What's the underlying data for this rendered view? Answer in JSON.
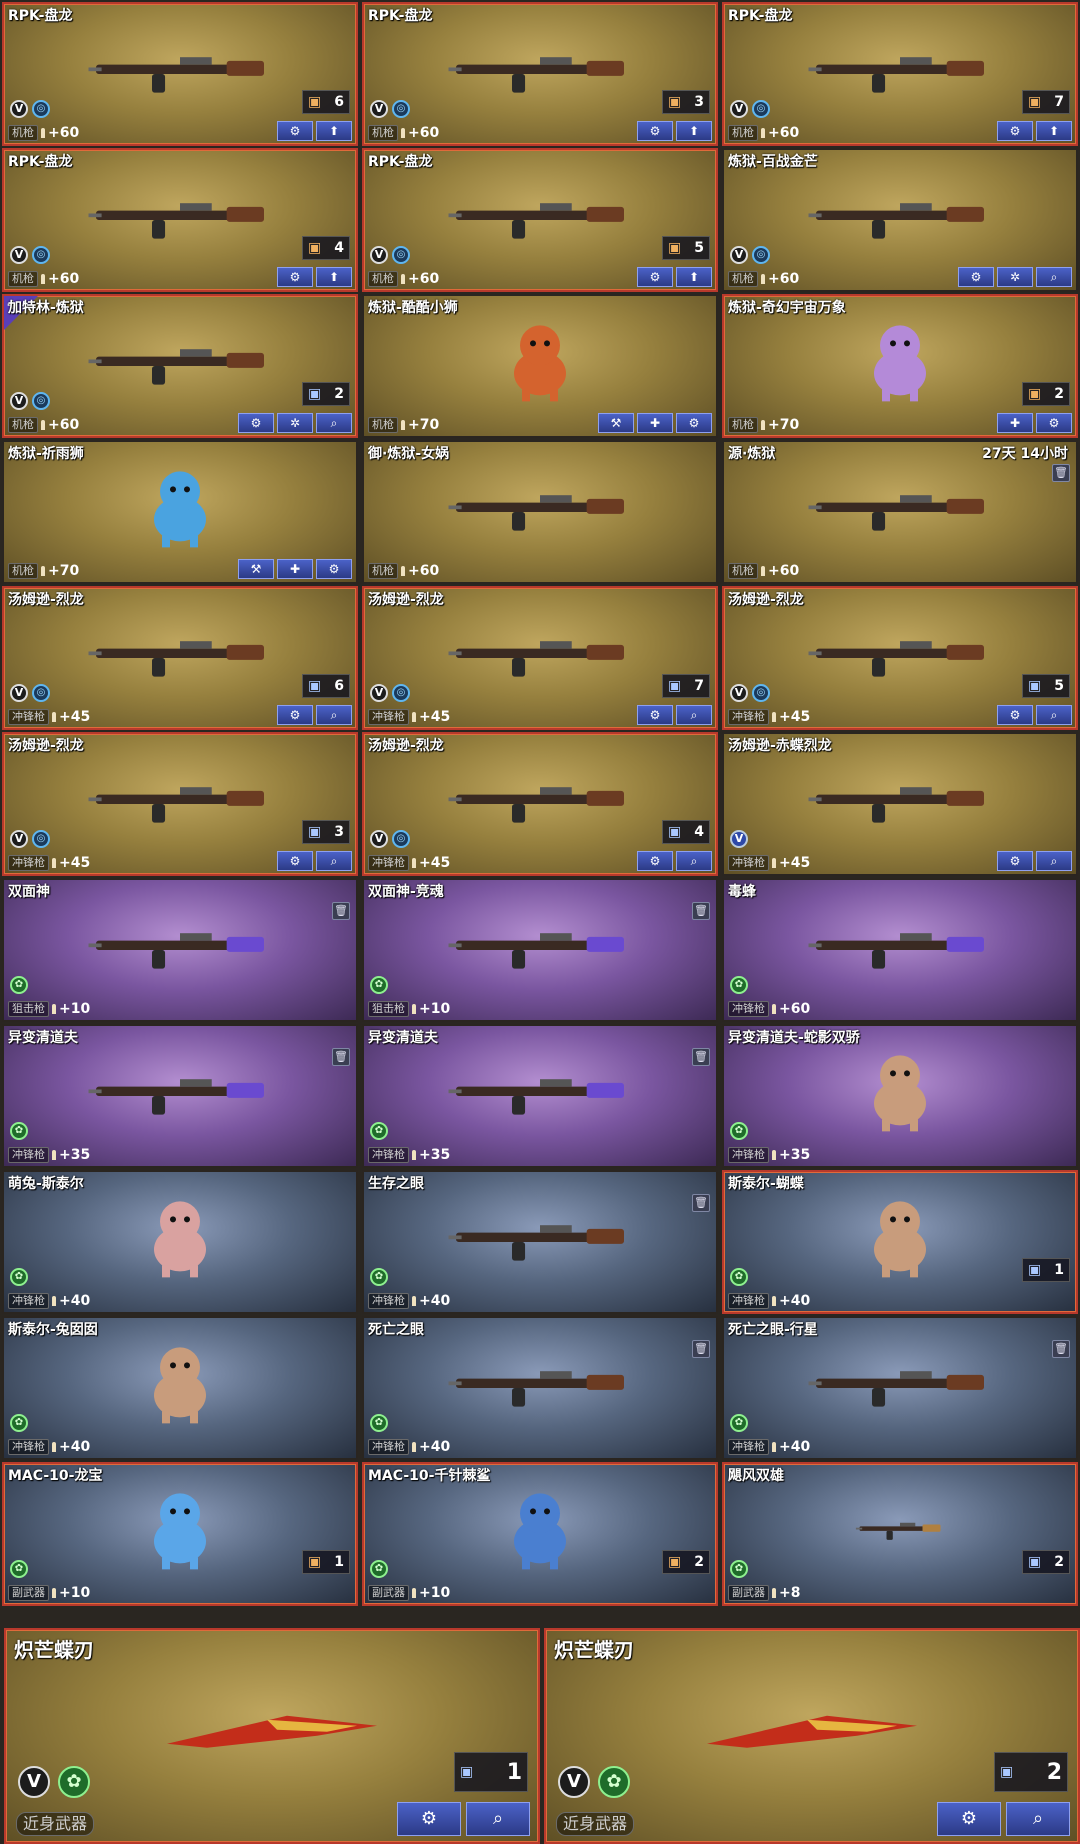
{
  "cards": [
    {
      "name": "RPK-盘龙",
      "type": "机枪",
      "stat": "+60",
      "count": "6",
      "bg": "gold",
      "hl": true,
      "art": "gun-icon",
      "badges": [
        "v",
        "ring"
      ],
      "box": "orange",
      "buttons": [
        "gear-wrench-icon",
        "up-arrow-icon"
      ]
    },
    {
      "name": "RPK-盘龙",
      "type": "机枪",
      "stat": "+60",
      "count": "3",
      "bg": "gold",
      "hl": true,
      "art": "gun-icon",
      "badges": [
        "v",
        "ring"
      ],
      "box": "orange",
      "buttons": [
        "gear-wrench-icon",
        "up-arrow-icon"
      ]
    },
    {
      "name": "RPK-盘龙",
      "type": "机枪",
      "stat": "+60",
      "count": "7",
      "bg": "gold",
      "hl": true,
      "art": "gun-icon",
      "badges": [
        "v",
        "ring"
      ],
      "box": "orange",
      "buttons": [
        "gear-wrench-icon",
        "up-arrow-icon"
      ]
    },
    {
      "name": "RPK-盘龙",
      "type": "机枪",
      "stat": "+60",
      "count": "4",
      "bg": "gold",
      "hl": true,
      "art": "gun-icon",
      "badges": [
        "v",
        "ring"
      ],
      "box": "orange",
      "buttons": [
        "gear-wrench-icon",
        "up-arrow-icon"
      ]
    },
    {
      "name": "RPK-盘龙",
      "type": "机枪",
      "stat": "+60",
      "count": "5",
      "bg": "gold",
      "hl": true,
      "art": "gun-icon",
      "badges": [
        "v",
        "ring"
      ],
      "box": "orange",
      "buttons": [
        "gear-wrench-icon",
        "up-arrow-icon"
      ]
    },
    {
      "name": "炼狱-百战金芒",
      "type": "机枪",
      "stat": "+60",
      "count": "",
      "bg": "gold",
      "hl": false,
      "art": "gun-icon",
      "badges": [
        "v",
        "ring"
      ],
      "box": "",
      "buttons": [
        "gear-wrench-icon",
        "gear-icon",
        "search-icon"
      ]
    },
    {
      "name": "加特林-炼狱",
      "type": "机枪",
      "stat": "+60",
      "count": "2",
      "bg": "gold",
      "hl": true,
      "art": "gun-icon",
      "badges": [
        "v",
        "ring"
      ],
      "box": "blue",
      "buttons": [
        "gear-wrench-icon",
        "gear-icon",
        "search-icon"
      ],
      "corner": true
    },
    {
      "name": "炼狱-酷酷小狮",
      "type": "机枪",
      "stat": "+70",
      "count": "",
      "bg": "gold",
      "hl": false,
      "art": "lion-icon",
      "badges": [],
      "box": "",
      "buttons": [
        "hammer-icon",
        "tools-icon",
        "gear-wrench-icon"
      ]
    },
    {
      "name": "炼狱-奇幻宇宙万象",
      "type": "机枪",
      "stat": "+70",
      "count": "2",
      "bg": "gold",
      "hl": true,
      "art": "elephant-icon",
      "badges": [],
      "box": "orange",
      "buttons": [
        "tools-icon",
        "gear-wrench-icon"
      ]
    },
    {
      "name": "炼狱-祈雨狮",
      "type": "机枪",
      "stat": "+70",
      "count": "",
      "bg": "gold",
      "hl": false,
      "art": "lion-icon",
      "badges": [],
      "box": "",
      "buttons": [
        "hammer-icon",
        "tools-icon",
        "gear-wrench-icon"
      ]
    },
    {
      "name": "御·炼狱-女娲",
      "type": "机枪",
      "stat": "+60",
      "count": "",
      "bg": "gold",
      "hl": false,
      "art": "gun-icon",
      "badges": [],
      "box": "",
      "buttons": []
    },
    {
      "name": "源·炼狱",
      "type": "机枪",
      "stat": "+60",
      "count": "",
      "bg": "gold",
      "hl": false,
      "art": "gun-icon",
      "badges": [],
      "box": "",
      "buttons": [],
      "timer": "27天 14小时",
      "trash": true
    },
    {
      "name": "汤姆逊-烈龙",
      "type": "冲锋枪",
      "stat": "+45",
      "count": "6",
      "bg": "gold",
      "hl": true,
      "art": "gun-icon",
      "badges": [
        "v",
        "ring"
      ],
      "box": "blue",
      "buttons": [
        "gear-wrench-icon",
        "search-icon"
      ]
    },
    {
      "name": "汤姆逊-烈龙",
      "type": "冲锋枪",
      "stat": "+45",
      "count": "7",
      "bg": "gold",
      "hl": true,
      "art": "gun-icon",
      "badges": [
        "v",
        "ring"
      ],
      "box": "blue",
      "buttons": [
        "gear-wrench-icon",
        "search-icon"
      ]
    },
    {
      "name": "汤姆逊-烈龙",
      "type": "冲锋枪",
      "stat": "+45",
      "count": "5",
      "bg": "gold",
      "hl": true,
      "art": "gun-icon",
      "badges": [
        "v",
        "ring"
      ],
      "box": "blue",
      "buttons": [
        "gear-wrench-icon",
        "search-icon"
      ]
    },
    {
      "name": "汤姆逊-烈龙",
      "type": "冲锋枪",
      "stat": "+45",
      "count": "3",
      "bg": "gold",
      "hl": true,
      "art": "gun-icon",
      "badges": [
        "v",
        "ring"
      ],
      "box": "blue",
      "buttons": [
        "gear-wrench-icon",
        "search-icon"
      ]
    },
    {
      "name": "汤姆逊-烈龙",
      "type": "冲锋枪",
      "stat": "+45",
      "count": "4",
      "bg": "gold",
      "hl": true,
      "art": "gun-icon",
      "badges": [
        "v",
        "ring"
      ],
      "box": "blue",
      "buttons": [
        "gear-wrench-icon",
        "search-icon"
      ]
    },
    {
      "name": "汤姆逊-赤蝶烈龙",
      "type": "冲锋枪",
      "stat": "+45",
      "count": "",
      "bg": "gold",
      "hl": false,
      "art": "gun-icon",
      "badges": [
        "vblue"
      ],
      "box": "",
      "buttons": [
        "gear-wrench-icon",
        "search-icon"
      ]
    },
    {
      "name": "双面神",
      "type": "狙击枪",
      "stat": "+10",
      "count": "",
      "bg": "purple",
      "hl": false,
      "art": "gun-icon",
      "badges": [
        "green"
      ],
      "box": "",
      "buttons": [],
      "trash": true
    },
    {
      "name": "双面神-竞魂",
      "type": "狙击枪",
      "stat": "+10",
      "count": "",
      "bg": "purple",
      "hl": false,
      "art": "gun-icon",
      "badges": [
        "green"
      ],
      "box": "",
      "buttons": [],
      "trash": true
    },
    {
      "name": "毒蜂",
      "type": "冲锋枪",
      "stat": "+60",
      "count": "",
      "bg": "purple",
      "hl": false,
      "art": "gun-icon",
      "badges": [
        "green"
      ],
      "box": "",
      "buttons": []
    },
    {
      "name": "异变清道夫",
      "type": "冲锋枪",
      "stat": "+35",
      "count": "",
      "bg": "purple",
      "hl": false,
      "art": "gun-icon",
      "badges": [
        "green"
      ],
      "box": "",
      "buttons": [],
      "trash": true
    },
    {
      "name": "异变清道夫",
      "type": "冲锋枪",
      "stat": "+35",
      "count": "",
      "bg": "purple",
      "hl": false,
      "art": "gun-icon",
      "badges": [
        "green"
      ],
      "box": "",
      "buttons": [],
      "trash": true
    },
    {
      "name": "异变清道夫-蛇影双骄",
      "type": "冲锋枪",
      "stat": "+35",
      "count": "",
      "bg": "purple",
      "hl": false,
      "art": "character-icon",
      "badges": [
        "green"
      ],
      "box": "",
      "buttons": []
    },
    {
      "name": "萌兔-斯泰尔",
      "type": "冲锋枪",
      "stat": "+40",
      "count": "",
      "bg": "blue",
      "hl": false,
      "art": "rabbit-icon",
      "badges": [
        "green"
      ],
      "box": "",
      "buttons": []
    },
    {
      "name": "生存之眼",
      "type": "冲锋枪",
      "stat": "+40",
      "count": "",
      "bg": "blue",
      "hl": false,
      "art": "gun-icon",
      "badges": [
        "green"
      ],
      "box": "",
      "buttons": [],
      "trash": true
    },
    {
      "name": "斯泰尔-蝴蝶",
      "type": "冲锋枪",
      "stat": "+40",
      "count": "1",
      "bg": "blue",
      "hl": true,
      "art": "character-icon",
      "badges": [
        "green"
      ],
      "box": "blue",
      "buttons": []
    },
    {
      "name": "斯泰尔-兔囡囡",
      "type": "冲锋枪",
      "stat": "+40",
      "count": "",
      "bg": "blue",
      "hl": false,
      "art": "character-icon",
      "badges": [
        "green"
      ],
      "box": "",
      "buttons": []
    },
    {
      "name": "死亡之眼",
      "type": "冲锋枪",
      "stat": "+40",
      "count": "",
      "bg": "blue",
      "hl": false,
      "art": "gun-icon",
      "badges": [
        "green"
      ],
      "box": "",
      "buttons": [],
      "trash": true
    },
    {
      "name": "死亡之眼-行星",
      "type": "冲锋枪",
      "stat": "+40",
      "count": "",
      "bg": "blue",
      "hl": false,
      "art": "gun-icon",
      "badges": [
        "green"
      ],
      "box": "",
      "buttons": [],
      "trash": true
    },
    {
      "name": "MAC-10-龙宝",
      "type": "副武器",
      "stat": "+10",
      "count": "1",
      "bg": "blue",
      "hl": true,
      "art": "dragon-icon",
      "badges": [
        "green"
      ],
      "box": "orange",
      "buttons": []
    },
    {
      "name": "MAC-10-千针棘鲨",
      "type": "副武器",
      "stat": "+10",
      "count": "2",
      "bg": "blue",
      "hl": true,
      "art": "shark-icon",
      "badges": [
        "green"
      ],
      "box": "orange",
      "buttons": []
    },
    {
      "name": "飓风双雄",
      "type": "副武器",
      "stat": "+8",
      "count": "2",
      "bg": "blue",
      "hl": true,
      "art": "pistol-icon",
      "badges": [
        "green"
      ],
      "box": "blue",
      "buttons": []
    },
    {
      "name": "炽芒蝶刃",
      "type": "近身武器",
      "stat": "",
      "count": "1",
      "bg": "gold",
      "hl": true,
      "art": "blade-icon",
      "badges": [
        "v",
        "green"
      ],
      "box": "blue",
      "buttons": [
        "gear-wrench-icon",
        "search-icon"
      ],
      "big": true
    },
    {
      "name": "炽芒蝶刃",
      "type": "近身武器",
      "stat": "",
      "count": "2",
      "bg": "gold",
      "hl": true,
      "art": "blade-icon",
      "badges": [
        "v",
        "green"
      ],
      "box": "blue",
      "buttons": [
        "gear-wrench-icon",
        "search-icon"
      ],
      "big": true
    }
  ],
  "icons": {
    "gear-wrench-icon": "⚙",
    "gear-icon": "✲",
    "up-arrow-icon": "⬆",
    "search-icon": "⌕",
    "hammer-icon": "⚒",
    "tools-icon": "✚"
  },
  "colors": {
    "highlight_border": "#b8392c",
    "button_blue": "#3a4fb0",
    "gold_bg": "#a08a48",
    "purple_bg": "#8a66b0",
    "blue_bg": "#56667f"
  }
}
